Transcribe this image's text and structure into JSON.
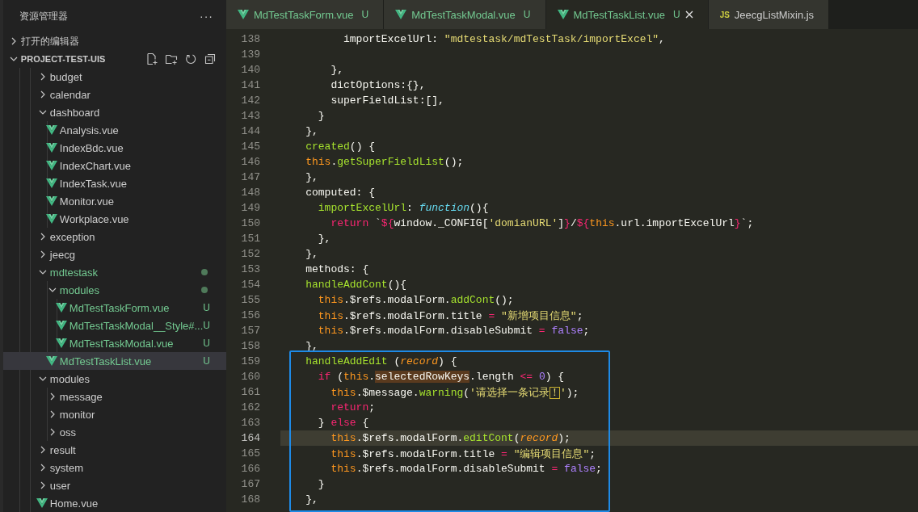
{
  "explorer": {
    "title": "资源管理器",
    "more": "···",
    "sections": [
      {
        "label": "打开的编辑器",
        "expanded": false,
        "tools": false
      },
      {
        "label": "PROJECT-TEST-UIS",
        "expanded": true,
        "tools": true
      }
    ],
    "tree": [
      {
        "name": "budget",
        "kind": "folder",
        "expanded": false,
        "selected": false
      },
      {
        "name": "calendar",
        "kind": "folder",
        "expanded": false,
        "selected": false
      },
      {
        "name": "dashboard",
        "kind": "folder",
        "expanded": true,
        "selected": false,
        "children": [
          {
            "name": "Analysis.vue",
            "kind": "vue",
            "selected": false
          },
          {
            "name": "IndexBdc.vue",
            "kind": "vue",
            "selected": false
          },
          {
            "name": "IndexChart.vue",
            "kind": "vue",
            "selected": false
          },
          {
            "name": "IndexTask.vue",
            "kind": "vue",
            "selected": false
          },
          {
            "name": "Monitor.vue",
            "kind": "vue",
            "selected": false
          },
          {
            "name": "Workplace.vue",
            "kind": "vue",
            "selected": false
          }
        ]
      },
      {
        "name": "exception",
        "kind": "folder",
        "expanded": false,
        "selected": false
      },
      {
        "name": "jeecg",
        "kind": "folder",
        "expanded": false,
        "selected": false
      },
      {
        "name": "mdtestask",
        "kind": "folder",
        "expanded": true,
        "selected": false,
        "modified": true,
        "children": [
          {
            "name": "modules",
            "kind": "folder",
            "expanded": true,
            "selected": false,
            "modified": true,
            "children": [
              {
                "name": "MdTestTaskForm.vue",
                "kind": "vue",
                "selected": false,
                "status": "U"
              },
              {
                "name": "MdTestTaskModal__Style#...",
                "kind": "vue",
                "selected": false,
                "status": "U"
              },
              {
                "name": "MdTestTaskModal.vue",
                "kind": "vue",
                "selected": false,
                "status": "U"
              }
            ]
          },
          {
            "name": "MdTestTaskList.vue",
            "kind": "vue",
            "selected": true,
            "status": "U"
          }
        ]
      },
      {
        "name": "modules",
        "kind": "folder",
        "expanded": true,
        "selected": false,
        "children": [
          {
            "name": "message",
            "kind": "folder",
            "expanded": false,
            "selected": false
          },
          {
            "name": "monitor",
            "kind": "folder",
            "expanded": false,
            "selected": false
          },
          {
            "name": "oss",
            "kind": "folder",
            "expanded": false,
            "selected": false
          }
        ]
      },
      {
        "name": "result",
        "kind": "folder",
        "expanded": false,
        "selected": false
      },
      {
        "name": "system",
        "kind": "folder",
        "expanded": false,
        "selected": false
      },
      {
        "name": "user",
        "kind": "folder",
        "expanded": false,
        "selected": false
      },
      {
        "name": "Home.vue",
        "kind": "vue",
        "selected": false
      }
    ]
  },
  "tabs": [
    {
      "label": "MdTestTaskForm.vue",
      "kind": "vue",
      "status": "U",
      "selected": false
    },
    {
      "label": "MdTestTaskModal.vue",
      "kind": "vue",
      "status": "U",
      "selected": false
    },
    {
      "label": "MdTestTaskList.vue",
      "kind": "vue",
      "status": "U",
      "selected": true
    },
    {
      "label": "JeecgListMixin.js",
      "kind": "js",
      "icon_text": "JS",
      "selected": false
    }
  ],
  "code": [
    {
      "number": "138",
      "current": false,
      "framed": false,
      "tokens": [
        {
          "kind": "plain",
          "text": "          importExcelUrl: "
        },
        {
          "kind": "string",
          "text": "\"mdtestask/mdTestTask/importExcel\""
        },
        {
          "kind": "plain",
          "text": ","
        }
      ]
    },
    {
      "number": "139",
      "current": false,
      "framed": false
    },
    {
      "number": "140",
      "current": false,
      "framed": false,
      "tokens": [
        {
          "kind": "plain",
          "text": "        },"
        }
      ]
    },
    {
      "number": "141",
      "current": false,
      "framed": false,
      "tokens": [
        {
          "kind": "plain",
          "text": "        dictOptions:{},"
        }
      ]
    },
    {
      "number": "142",
      "current": false,
      "framed": false,
      "tokens": [
        {
          "kind": "plain",
          "text": "        superFieldList:[],"
        }
      ]
    },
    {
      "number": "143",
      "current": false,
      "framed": false,
      "tokens": [
        {
          "kind": "plain",
          "text": "      }"
        }
      ]
    },
    {
      "number": "144",
      "current": false,
      "framed": false,
      "tokens": [
        {
          "kind": "plain",
          "text": "    },"
        }
      ]
    },
    {
      "number": "145",
      "current": false,
      "framed": false,
      "tokens": [
        {
          "kind": "function",
          "text": "    created"
        },
        {
          "kind": "plain",
          "text": "() {"
        }
      ]
    },
    {
      "number": "146",
      "current": false,
      "framed": false,
      "tokens": [
        {
          "kind": "this",
          "text": "    this"
        },
        {
          "kind": "plain",
          "text": "."
        },
        {
          "kind": "function",
          "text": "getSuperFieldList"
        },
        {
          "kind": "plain",
          "text": "();"
        }
      ]
    },
    {
      "number": "147",
      "current": false,
      "framed": false,
      "tokens": [
        {
          "kind": "plain",
          "text": "    },"
        }
      ]
    },
    {
      "number": "148",
      "current": false,
      "framed": false,
      "tokens": [
        {
          "kind": "plain",
          "text": "    computed: {"
        }
      ]
    },
    {
      "number": "149",
      "current": false,
      "framed": false,
      "tokens": [
        {
          "kind": "function",
          "text": "      importExcelUrl"
        },
        {
          "kind": "plain",
          "text": ": "
        },
        {
          "kind": "type",
          "text": "function"
        },
        {
          "kind": "plain",
          "text": "(){"
        }
      ]
    },
    {
      "number": "150",
      "current": false,
      "framed": false,
      "tokens": [
        {
          "kind": "keyword",
          "text": "        return"
        },
        {
          "kind": "plain",
          "text": " `"
        },
        {
          "kind": "keyword",
          "text": "${"
        },
        {
          "kind": "plain",
          "text": "window._CONFIG["
        },
        {
          "kind": "string",
          "text": "'domianURL'"
        },
        {
          "kind": "plain",
          "text": "]"
        },
        {
          "kind": "keyword",
          "text": "}"
        },
        {
          "kind": "plain",
          "text": "/"
        },
        {
          "kind": "keyword",
          "text": "${"
        },
        {
          "kind": "this",
          "text": "this"
        },
        {
          "kind": "plain",
          "text": ".url.importExcelUrl"
        },
        {
          "kind": "keyword",
          "text": "}"
        },
        {
          "kind": "plain",
          "text": "`;"
        }
      ]
    },
    {
      "number": "151",
      "current": false,
      "framed": false,
      "tokens": [
        {
          "kind": "plain",
          "text": "      },"
        }
      ]
    },
    {
      "number": "152",
      "current": false,
      "framed": false,
      "tokens": [
        {
          "kind": "plain",
          "text": "    },"
        }
      ]
    },
    {
      "number": "153",
      "current": false,
      "framed": false,
      "tokens": [
        {
          "kind": "plain",
          "text": "    methods: {"
        }
      ]
    },
    {
      "number": "154",
      "current": false,
      "framed": false,
      "tokens": [
        {
          "kind": "function",
          "text": "    handleAddCont"
        },
        {
          "kind": "plain",
          "text": "(){"
        }
      ]
    },
    {
      "number": "155",
      "current": false,
      "framed": false,
      "tokens": [
        {
          "kind": "this",
          "text": "      this"
        },
        {
          "kind": "plain",
          "text": ".$refs.modalForm."
        },
        {
          "kind": "function",
          "text": "addCont"
        },
        {
          "kind": "plain",
          "text": "();"
        }
      ]
    },
    {
      "number": "156",
      "current": false,
      "framed": false,
      "tokens": [
        {
          "kind": "this",
          "text": "      this"
        },
        {
          "kind": "plain",
          "text": ".$refs.modalForm.title "
        },
        {
          "kind": "keyword",
          "text": "="
        },
        {
          "kind": "string",
          "text": " \"新增项目信息\""
        },
        {
          "kind": "plain",
          "text": ";"
        }
      ]
    },
    {
      "number": "157",
      "current": false,
      "framed": false,
      "tokens": [
        {
          "kind": "this",
          "text": "      this"
        },
        {
          "kind": "plain",
          "text": ".$refs.modalForm.disableSubmit "
        },
        {
          "kind": "keyword",
          "text": "="
        },
        {
          "kind": "constant",
          "text": " false"
        },
        {
          "kind": "plain",
          "text": ";"
        }
      ]
    },
    {
      "number": "158",
      "current": false,
      "framed": false,
      "tokens": [
        {
          "kind": "plain",
          "text": "    },"
        }
      ]
    },
    {
      "number": "159",
      "current": false,
      "framed": true,
      "tokens": [
        {
          "kind": "function",
          "text": "    handleAddEdit"
        },
        {
          "kind": "plain",
          "text": " ("
        },
        {
          "kind": "param",
          "text": "record"
        },
        {
          "kind": "plain",
          "text": ") {"
        }
      ]
    },
    {
      "number": "160",
      "current": false,
      "framed": true,
      "tokens": [
        {
          "kind": "keyword",
          "text": "      if"
        },
        {
          "kind": "plain",
          "text": " ("
        },
        {
          "kind": "this",
          "text": "this"
        },
        {
          "kind": "plain",
          "text": "."
        },
        {
          "kind": "match",
          "text": "selectedRowKeys"
        },
        {
          "kind": "plain",
          "text": ".length "
        },
        {
          "kind": "keyword",
          "text": "<="
        },
        {
          "kind": "constant",
          "text": " 0"
        },
        {
          "kind": "plain",
          "text": ") {"
        }
      ]
    },
    {
      "number": "161",
      "current": false,
      "framed": true,
      "tokens": [
        {
          "kind": "this",
          "text": "        this"
        },
        {
          "kind": "plain",
          "text": ".$message."
        },
        {
          "kind": "function",
          "text": "warning"
        },
        {
          "kind": "plain",
          "text": "("
        },
        {
          "kind": "string",
          "text": "'请选择一条记录"
        },
        {
          "kind": "boxed",
          "text": "！"
        },
        {
          "kind": "string",
          "text": "'"
        },
        {
          "kind": "plain",
          "text": ");"
        }
      ]
    },
    {
      "number": "162",
      "current": false,
      "framed": true,
      "tokens": [
        {
          "kind": "keyword",
          "text": "        return"
        },
        {
          "kind": "plain",
          "text": ";"
        }
      ]
    },
    {
      "number": "163",
      "current": false,
      "framed": true,
      "tokens": [
        {
          "kind": "plain",
          "text": "      } "
        },
        {
          "kind": "keyword",
          "text": "else"
        },
        {
          "kind": "plain",
          "text": " {"
        }
      ]
    },
    {
      "number": "164",
      "current": true,
      "framed": true,
      "tokens": [
        {
          "kind": "this",
          "text": "        this"
        },
        {
          "kind": "plain",
          "text": ".$refs.modalForm."
        },
        {
          "kind": "function",
          "text": "editCont"
        },
        {
          "kind": "plain",
          "text": "("
        },
        {
          "kind": "param",
          "text": "record"
        },
        {
          "kind": "plain",
          "text": ");"
        }
      ]
    },
    {
      "number": "165",
      "current": false,
      "framed": true,
      "tokens": [
        {
          "kind": "this",
          "text": "        this"
        },
        {
          "kind": "plain",
          "text": ".$refs.modalForm.title "
        },
        {
          "kind": "keyword",
          "text": "="
        },
        {
          "kind": "string",
          "text": " \"编辑项目信息\""
        },
        {
          "kind": "plain",
          "text": ";"
        }
      ]
    },
    {
      "number": "166",
      "current": false,
      "framed": true,
      "tokens": [
        {
          "kind": "this",
          "text": "        this"
        },
        {
          "kind": "plain",
          "text": ".$refs.modalForm.disableSubmit "
        },
        {
          "kind": "keyword",
          "text": "="
        },
        {
          "kind": "constant",
          "text": " false"
        },
        {
          "kind": "plain",
          "text": ";"
        }
      ]
    },
    {
      "number": "167",
      "current": false,
      "framed": true,
      "tokens": [
        {
          "kind": "plain",
          "text": "      }"
        }
      ]
    },
    {
      "number": "168",
      "current": false,
      "framed": true,
      "tokens": [
        {
          "kind": "plain",
          "text": "    },"
        }
      ]
    }
  ]
}
